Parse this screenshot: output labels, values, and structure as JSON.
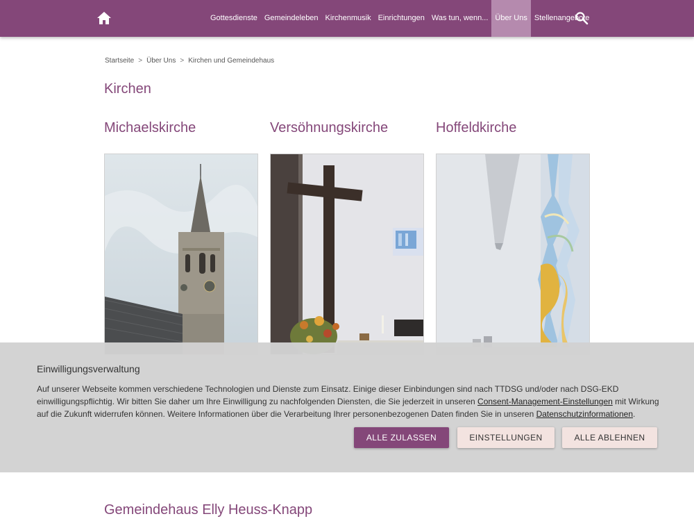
{
  "header": {
    "nav": [
      {
        "label": "Gottesdienste"
      },
      {
        "label": "Gemeindeleben"
      },
      {
        "label": "Kirchenmusik"
      },
      {
        "label": "Einrichtungen"
      },
      {
        "label": "Was tun, wenn..."
      },
      {
        "label": "Über Uns",
        "active": true
      },
      {
        "label": "Stellenangebote"
      }
    ]
  },
  "breadcrumb": {
    "items": [
      "Startseite",
      "Über Uns",
      "Kirchen und Gemeindehaus"
    ],
    "separator": ">"
  },
  "section_title": "Kirchen",
  "churches": [
    {
      "name": "Michaelskirche"
    },
    {
      "name": "Versöhnungskirche"
    },
    {
      "name": "Hoffeldkirche"
    }
  ],
  "consent": {
    "title": "Einwilligungsverwaltung",
    "text_1": "Auf unserer Webseite kommen verschiedene Technologien und Dienste zum Einsatz. Einige dieser Einbindungen sind nach TTDSG und/oder nach DSG-EKD einwilligungspflichtig. Wir bitten Sie daher um Ihre Einwilligung zu nachfolgenden Diensten, die Sie jederzeit in unseren ",
    "link_1": "Consent-Management-Einstellungen",
    "text_2": " mit Wirkung auf die Zukunft widerrufen können. Weitere Informationen über die Verarbeitung Ihrer personenbezogenen Daten finden Sie in unseren ",
    "link_2": "Datenschutzinformationen",
    "text_3": ".",
    "accept_label": "ALLE ZULASSEN",
    "settings_label": "EINSTELLUNGEN",
    "decline_label": "ALLE ABLEHNEN"
  },
  "gemeindehaus_title": "Gemeindehaus Elly Heuss-Knapp",
  "colors": {
    "brand": "#844779",
    "nav_active": "#b58aae",
    "button_light": "#f3e3e0"
  }
}
